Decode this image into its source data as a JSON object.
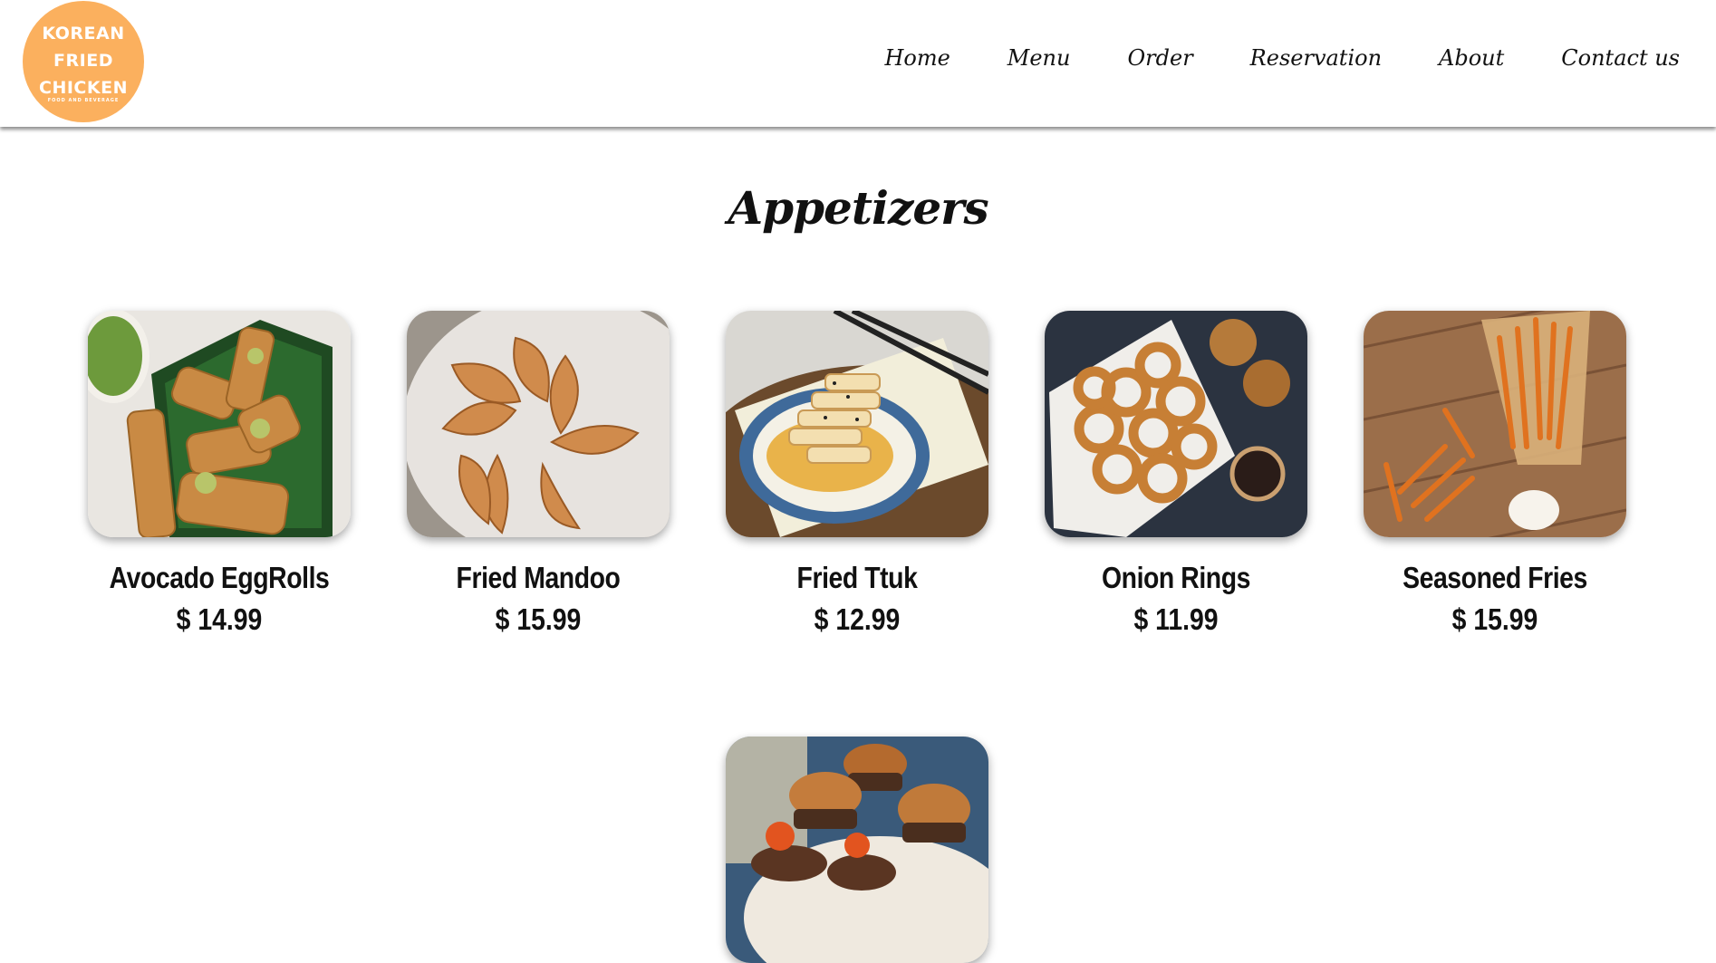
{
  "brand": {
    "logo_lines": [
      "KOREAN",
      "FRIED",
      "CHICKEN"
    ],
    "logo_tagline": "FOOD AND BEVERAGE",
    "logo_color": "#fbb05e"
  },
  "nav": {
    "items": [
      "Home",
      "Menu",
      "Order",
      "Reservation",
      "About",
      "Contact us"
    ]
  },
  "section": {
    "title": "Appetizers"
  },
  "items": [
    {
      "name": "Avocado EggRolls",
      "price": "$ 14.99",
      "image": "avocado-eggrolls-photo"
    },
    {
      "name": "Fried Mandoo",
      "price": "$ 15.99",
      "image": "fried-mandoo-photo"
    },
    {
      "name": "Fried Ttuk",
      "price": "$ 12.99",
      "image": "fried-ttuk-photo"
    },
    {
      "name": "Onion Rings",
      "price": "$ 11.99",
      "image": "onion-rings-photo"
    },
    {
      "name": "Seasoned Fries",
      "price": "$ 15.99",
      "image": "seasoned-fries-photo"
    },
    {
      "name": "",
      "price": "",
      "image": "sliders-photo"
    }
  ]
}
